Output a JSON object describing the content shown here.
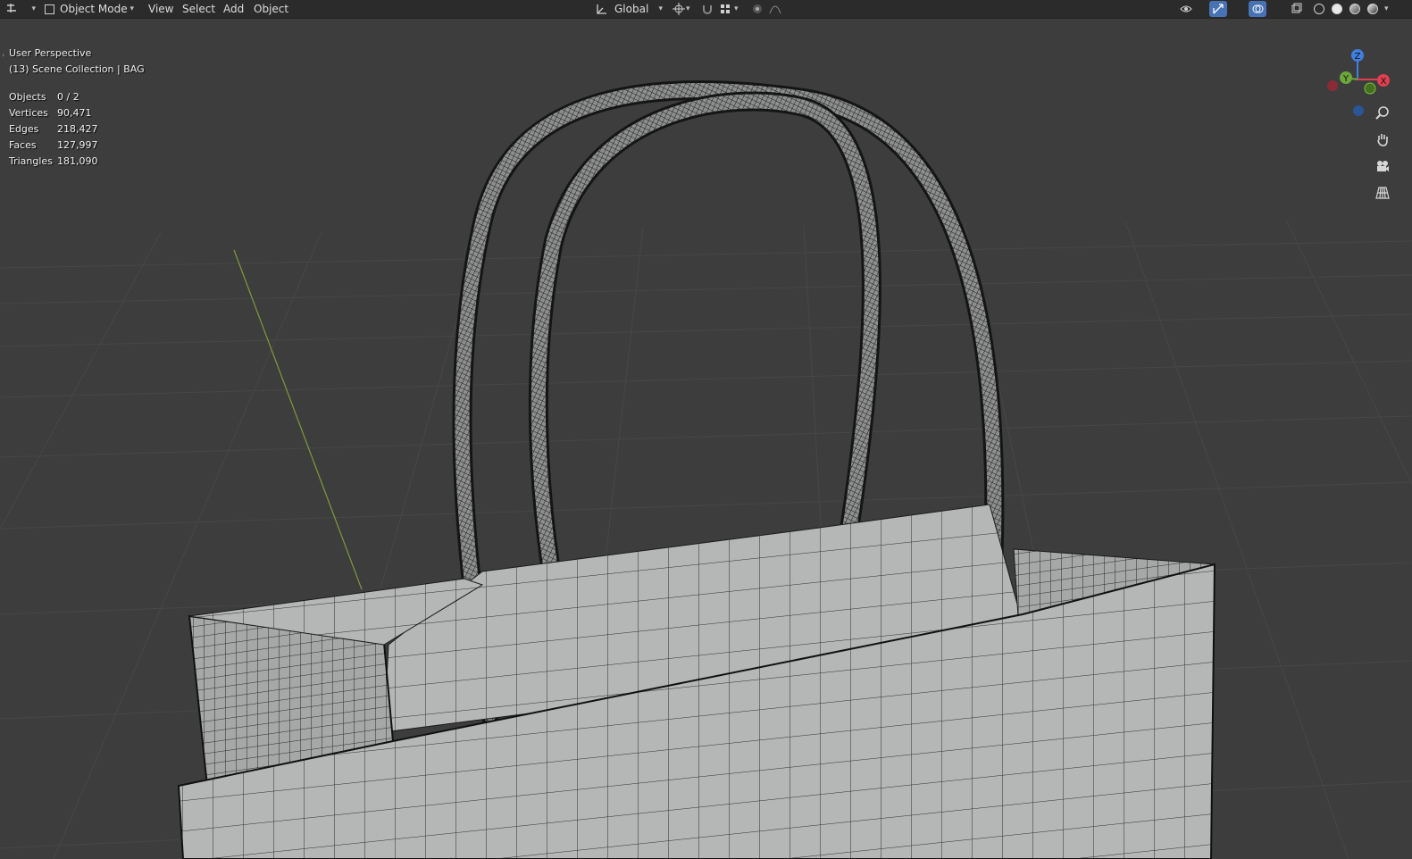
{
  "header": {
    "mode_label": "Object Mode",
    "menus": [
      "View",
      "Select",
      "Add",
      "Object"
    ],
    "orientation_label": "Global"
  },
  "viewport": {
    "view_name": "User Perspective",
    "collection": "(13) Scene Collection | BAG",
    "stats": [
      {
        "label": "Objects",
        "value": "0 / 2"
      },
      {
        "label": "Vertices",
        "value": "90,471"
      },
      {
        "label": "Edges",
        "value": "218,427"
      },
      {
        "label": "Faces",
        "value": "127,997"
      },
      {
        "label": "Triangles",
        "value": "181,090"
      }
    ]
  },
  "gizmo": {
    "z_label": "Z",
    "y_label": "Y",
    "x_label": "X",
    "colors": {
      "x": "#e0404f",
      "y": "#6ba73a",
      "z": "#3e7fe0"
    }
  },
  "nav_icons": [
    "zoom-icon",
    "pan-hand-icon",
    "camera-icon",
    "grid-view-icon"
  ],
  "colors": {
    "background": "#3d3d3d",
    "header": "#2b2b2b",
    "accent": "#4772b3",
    "mesh": "#b5b8b6"
  }
}
